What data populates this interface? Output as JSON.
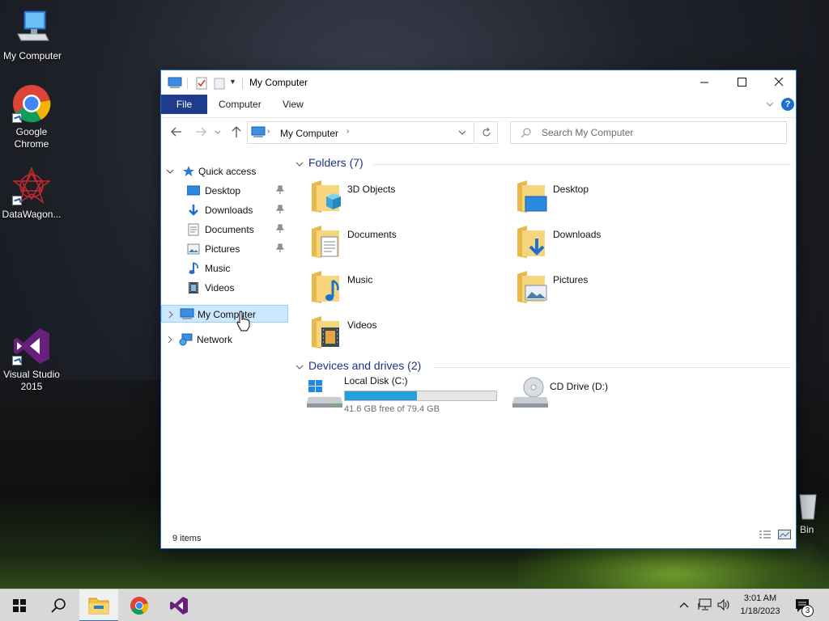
{
  "desktop": {
    "icons": [
      {
        "label": "My Computer"
      },
      {
        "label": "Google Chrome"
      },
      {
        "label": "DataWagon..."
      },
      {
        "label": "Visual Studio 2015"
      },
      {
        "label": "Bin"
      }
    ]
  },
  "window": {
    "title": "My Computer",
    "ribbon_tabs": {
      "file": "File",
      "computer": "Computer",
      "view": "View"
    },
    "address_crumb": "My Computer",
    "search_placeholder": "Search My Computer",
    "status_items": "9 items"
  },
  "navpane": {
    "quick_access": "Quick access",
    "items": [
      {
        "label": "Desktop",
        "pinned": true
      },
      {
        "label": "Downloads",
        "pinned": true
      },
      {
        "label": "Documents",
        "pinned": true
      },
      {
        "label": "Pictures",
        "pinned": true
      },
      {
        "label": "Music",
        "pinned": false
      },
      {
        "label": "Videos",
        "pinned": false
      }
    ],
    "my_computer": "My Computer",
    "network": "Network"
  },
  "content": {
    "folders_header": "Folders (7)",
    "folders": [
      {
        "name": "3D Objects"
      },
      {
        "name": "Desktop"
      },
      {
        "name": "Documents"
      },
      {
        "name": "Downloads"
      },
      {
        "name": "Music"
      },
      {
        "name": "Pictures"
      },
      {
        "name": "Videos"
      }
    ],
    "drives_header": "Devices and drives (2)",
    "drives": [
      {
        "name": "Local Disk (C:)",
        "free_text": "41.6 GB free of 79.4 GB",
        "used_fraction": 0.476
      },
      {
        "name": "CD Drive (D:)"
      }
    ]
  },
  "taskbar": {
    "time": "3:01 AM",
    "date": "1/18/2023",
    "notification_count": "3"
  },
  "colors": {
    "accent": "#1e3b8c",
    "selection": "#cce8ff",
    "group_header": "#1e3287",
    "drive_fill": "#26a0da"
  }
}
